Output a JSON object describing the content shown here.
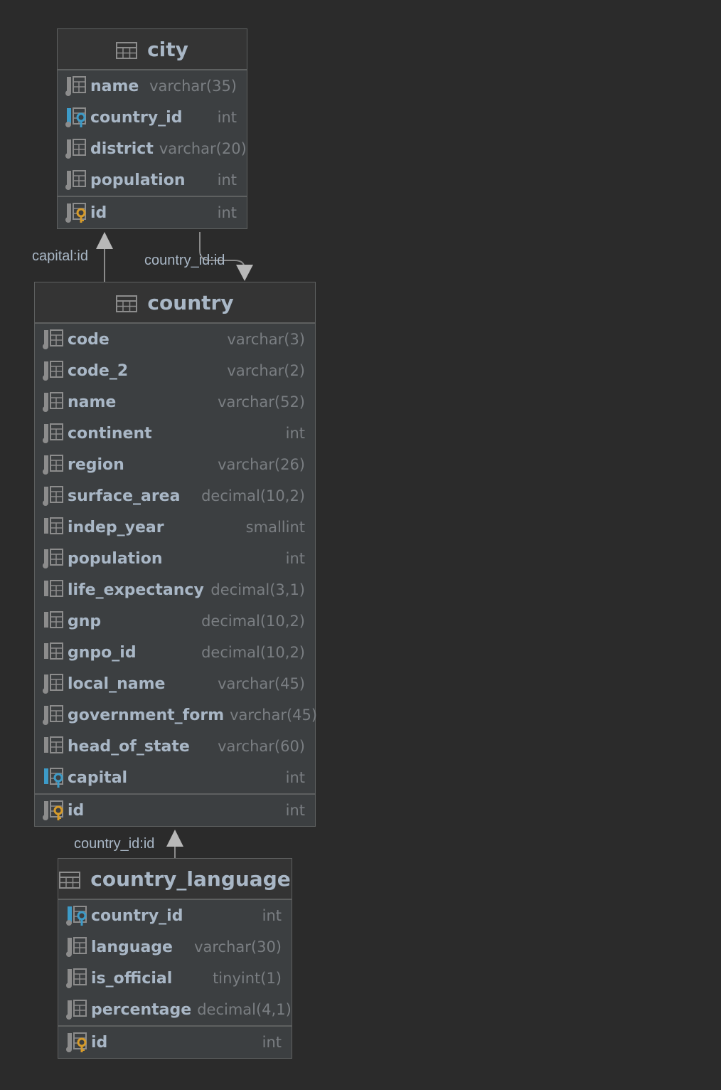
{
  "tables": {
    "city": {
      "name": "city",
      "fields": [
        {
          "name": "name",
          "type": "varchar(35)",
          "kind": "column"
        },
        {
          "name": "country_id",
          "type": "int",
          "kind": "foreign-key"
        },
        {
          "name": "district",
          "type": "varchar(20)",
          "kind": "column"
        },
        {
          "name": "population",
          "type": "int",
          "kind": "column"
        }
      ],
      "pk": {
        "name": "id",
        "type": "int"
      }
    },
    "country": {
      "name": "country",
      "fields": [
        {
          "name": "code",
          "type": "varchar(3)",
          "kind": "column"
        },
        {
          "name": "code_2",
          "type": "varchar(2)",
          "kind": "column"
        },
        {
          "name": "name",
          "type": "varchar(52)",
          "kind": "column"
        },
        {
          "name": "continent",
          "type": "int",
          "kind": "column"
        },
        {
          "name": "region",
          "type": "varchar(26)",
          "kind": "column"
        },
        {
          "name": "surface_area",
          "type": "decimal(10,2)",
          "kind": "column"
        },
        {
          "name": "indep_year",
          "type": "smallint",
          "kind": "column-nullable"
        },
        {
          "name": "population",
          "type": "int",
          "kind": "column"
        },
        {
          "name": "life_expectancy",
          "type": "decimal(3,1)",
          "kind": "column-nullable"
        },
        {
          "name": "gnp",
          "type": "decimal(10,2)",
          "kind": "column-nullable"
        },
        {
          "name": "gnpo_id",
          "type": "decimal(10,2)",
          "kind": "column-nullable"
        },
        {
          "name": "local_name",
          "type": "varchar(45)",
          "kind": "column"
        },
        {
          "name": "government_form",
          "type": "varchar(45)",
          "kind": "column"
        },
        {
          "name": "head_of_state",
          "type": "varchar(60)",
          "kind": "column-nullable"
        },
        {
          "name": "capital",
          "type": "int",
          "kind": "foreign-key-nullable"
        }
      ],
      "pk": {
        "name": "id",
        "type": "int"
      }
    },
    "country_language": {
      "name": "country_language",
      "fields": [
        {
          "name": "country_id",
          "type": "int",
          "kind": "foreign-key"
        },
        {
          "name": "language",
          "type": "varchar(30)",
          "kind": "column"
        },
        {
          "name": "is_official",
          "type": "tinyint(1)",
          "kind": "column"
        },
        {
          "name": "percentage",
          "type": "decimal(4,1)",
          "kind": "column"
        }
      ],
      "pk": {
        "name": "id",
        "type": "int"
      }
    }
  },
  "relations": {
    "capital": "capital:id",
    "city_country": "country_id:id",
    "language_country": "country_id:id"
  },
  "colors": {
    "background": "#2b2b2b",
    "table_body": "#3c3f41",
    "text": "#a9b7c6",
    "type_text": "#7a7e82",
    "pk_key": "#d69b2b",
    "fk_key": "#3d9bc8"
  }
}
